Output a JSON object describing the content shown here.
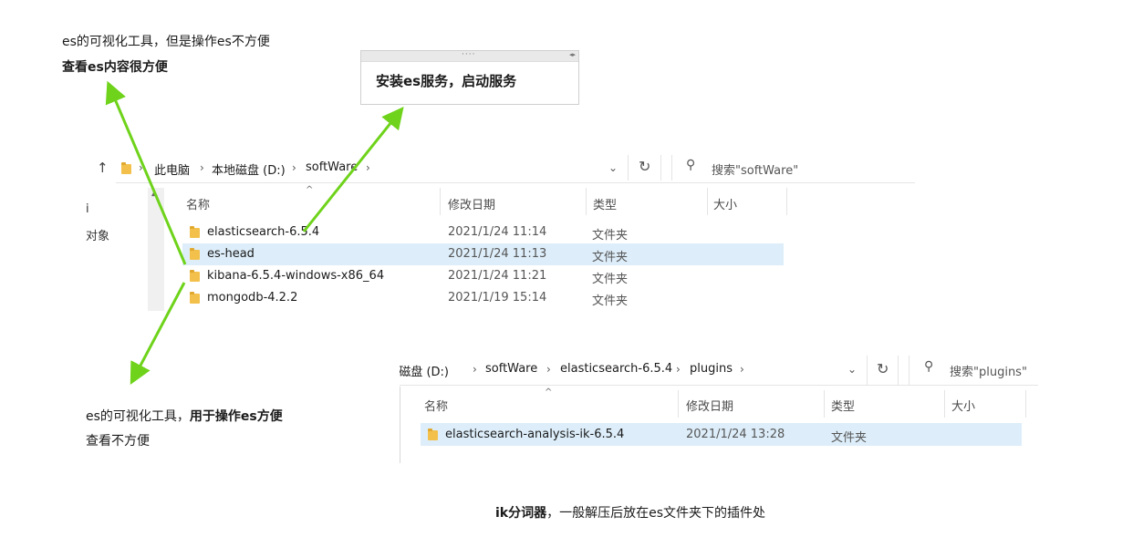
{
  "annotations": {
    "top_left_line1": "es的可视化工具，但是操作es不方便",
    "top_left_line2": "查看es内容很方便",
    "box_title": "安装es服务，启动服务",
    "bottom_left_line1_normal": "es的可视化工具，",
    "bottom_left_line1_bold": "用于操作es方便",
    "bottom_left_line2": "查看不方便",
    "bottom_center_bold": "ik分词器",
    "bottom_center_normal": "，一般解压后放在es文件夹下的插件处"
  },
  "explorer1": {
    "breadcrumb": [
      "此电脑",
      "本地磁盘 (D:)",
      "softWare"
    ],
    "search_placeholder": "搜索\"softWare\"",
    "columns": [
      "名称",
      "修改日期",
      "类型",
      "大小"
    ],
    "sidebar_fragments": [
      "i",
      "对象"
    ],
    "rows": [
      {
        "name": "elasticsearch-6.5.4",
        "date": "2021/1/24 11:14",
        "type": "文件夹"
      },
      {
        "name": "es-head",
        "date": "2021/1/24 11:13",
        "type": "文件夹"
      },
      {
        "name": "kibana-6.5.4-windows-x86_64",
        "date": "2021/1/24 11:21",
        "type": "文件夹"
      },
      {
        "name": "mongodb-4.2.2",
        "date": "2021/1/19 15:14",
        "type": "文件夹"
      }
    ]
  },
  "explorer2": {
    "breadcrumb": [
      "本地磁盘 (D:)",
      "softWare",
      "elasticsearch-6.5.4",
      "plugins"
    ],
    "search_placeholder": "搜索\"plugins\"",
    "columns": [
      "名称",
      "修改日期",
      "类型",
      "大小"
    ],
    "rows": [
      {
        "name": "elasticsearch-analysis-ik-6.5.4",
        "date": "2021/1/24 13:28",
        "type": "文件夹"
      }
    ]
  },
  "colors": {
    "arrow": "#6ed31a",
    "selection": "#ddeefa",
    "folder": "#f3c14b"
  }
}
